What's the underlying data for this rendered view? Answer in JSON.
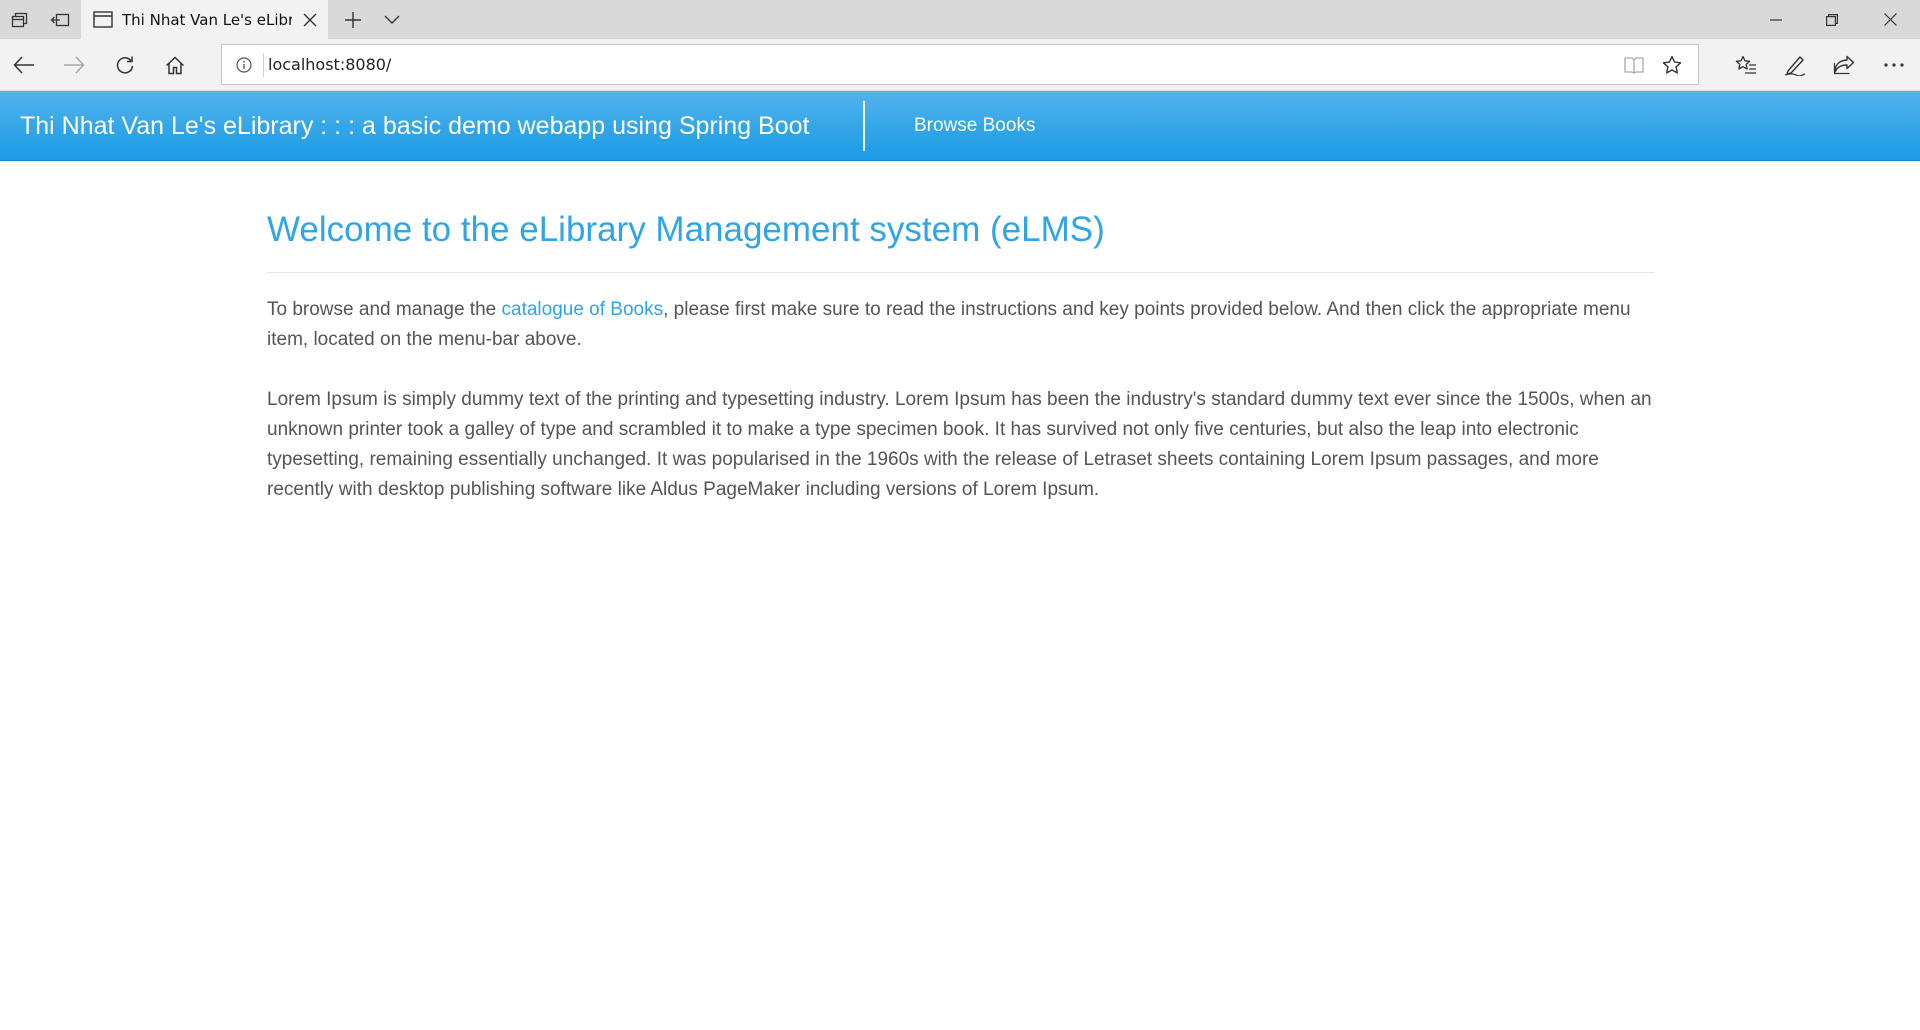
{
  "browser": {
    "tab_title": "Thi Nhat Van Le's eLibrary",
    "address": "localhost:8080/"
  },
  "navbar": {
    "brand": "Thi Nhat Van Le's eLibrary : : : a basic demo webapp using Spring Boot",
    "browse_books": "Browse Books",
    "color": "#2fa4e7"
  },
  "content": {
    "title": "Welcome to the eLibrary Management system (eLMS)",
    "intro_before_link": "To browse and manage the ",
    "intro_link": "catalogue of Books",
    "intro_after_link": ", please first make sure to read the instructions and key points provided below. And then click the appropriate menu item, located on the menu-bar above.",
    "lorem": "Lorem Ipsum is simply dummy text of the printing and typesetting industry. Lorem Ipsum has been the industry's standard dummy text ever since the 1500s, when an unknown printer took a galley of type and scrambled it to make a type specimen book. It has survived not only five centuries, but also the leap into electronic typesetting, remaining essentially unchanged. It was popularised in the 1960s with the release of Letraset sheets containing Lorem Ipsum passages, and more recently with desktop publishing software like Aldus PageMaker including versions of Lorem Ipsum."
  },
  "icons": {
    "tab_actions": "tab-actions-icon",
    "set_aside": "set-aside-tabs-icon",
    "new_tab": "plus-icon",
    "tab_list": "chevron-down-icon",
    "back": "arrow-left-icon",
    "forward": "arrow-right-icon",
    "refresh": "refresh-icon",
    "home": "home-icon",
    "favorites_hub": "favorites-list-icon",
    "notes": "pen-icon",
    "share": "share-icon",
    "more": "ellipsis-icon"
  }
}
